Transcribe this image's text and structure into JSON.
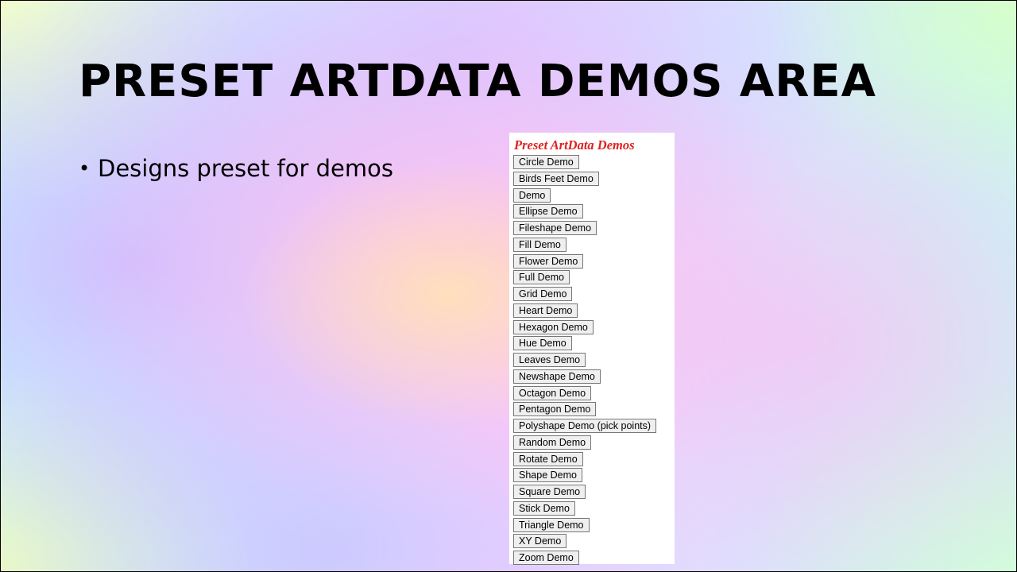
{
  "slide": {
    "title": "PRESET ARTDATA DEMOS AREA",
    "bullets": [
      "Designs preset for demos"
    ]
  },
  "panel": {
    "heading": "Preset ArtData Demos",
    "buttons": [
      "Circle Demo",
      "Birds Feet Demo",
      "Demo",
      "Ellipse Demo",
      "Fileshape Demo",
      "Fill Demo",
      "Flower Demo",
      "Full Demo",
      "Grid Demo",
      "Heart Demo",
      "Hexagon Demo",
      "Hue Demo",
      "Leaves Demo",
      "Newshape Demo",
      "Octagon Demo",
      "Pentagon Demo",
      "Polyshape Demo (pick points)",
      "Random Demo",
      "Rotate Demo",
      "Shape Demo",
      "Square Demo",
      "Stick Demo",
      "Triangle Demo",
      "XY Demo",
      "Zoom Demo"
    ]
  },
  "colors": {
    "heading": "#e02020",
    "button_bg": "#efefef",
    "button_border": "#767676"
  }
}
